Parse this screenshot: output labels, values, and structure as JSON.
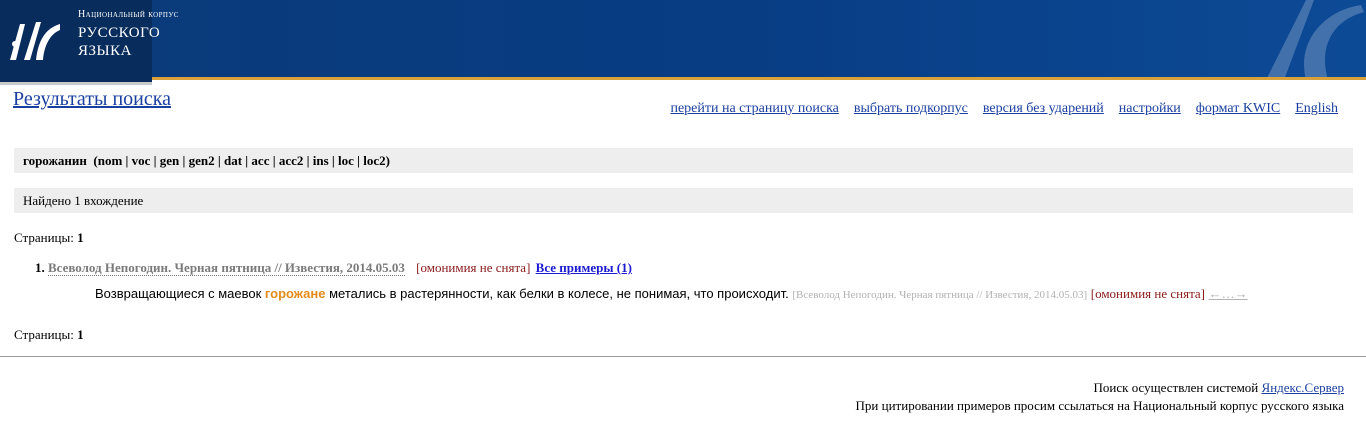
{
  "header": {
    "logo_line1": "Национальный корпус",
    "logo_line2": "РУССКОГО",
    "logo_line3": "ЯЗЫКА",
    "colors": {
      "background": "#083d84",
      "accent_strip": "#d9a13a"
    },
    "icon": "corpus-logo-icon"
  },
  "title": "Результаты поиска",
  "nav": [
    {
      "label": "перейти на страницу поиска"
    },
    {
      "label": "выбрать подкорпус"
    },
    {
      "label": "версия без ударений"
    },
    {
      "label": "настройки"
    },
    {
      "label": "формат KWIC"
    },
    {
      "label": "English"
    }
  ],
  "query": {
    "word": "горожанин",
    "grammar": "(nom | voc | gen | gen2 | dat | acc | acc2 | ins | loc | loc2)"
  },
  "found_text": "Найдено 1 вхождение",
  "pages_label": "Страницы:",
  "pages_value": "1",
  "result": {
    "number": "1.",
    "doc_title": "Всеволод Непогодин. Черная пятница // Известия, 2014.05.03",
    "homonymy": "[омонимия не снята]",
    "all_examples": "Все примеры (1)",
    "example_before": "Возвращающиеся с маевок ",
    "example_hit": "горожане",
    "example_after": " метались в растерянности, как белки в колесе, не понимая, что происходит. ",
    "source_ref": "[Всеволод Непогодин. Черная пятница // Известия, 2014.05.03]",
    "homonymy2": "[омонимия не снята]",
    "expand": "←…→",
    "colors": {
      "hit": "#e38c1c",
      "homonymy": "#8b1a1a",
      "muted": "#b2b2b2"
    }
  },
  "footer": {
    "line1_text": "Поиск осуществлен системой ",
    "line1_link": "Яндекс.Сервер",
    "line2": "При цитировании примеров просим ссылаться на Национальный корпус русского языка"
  }
}
